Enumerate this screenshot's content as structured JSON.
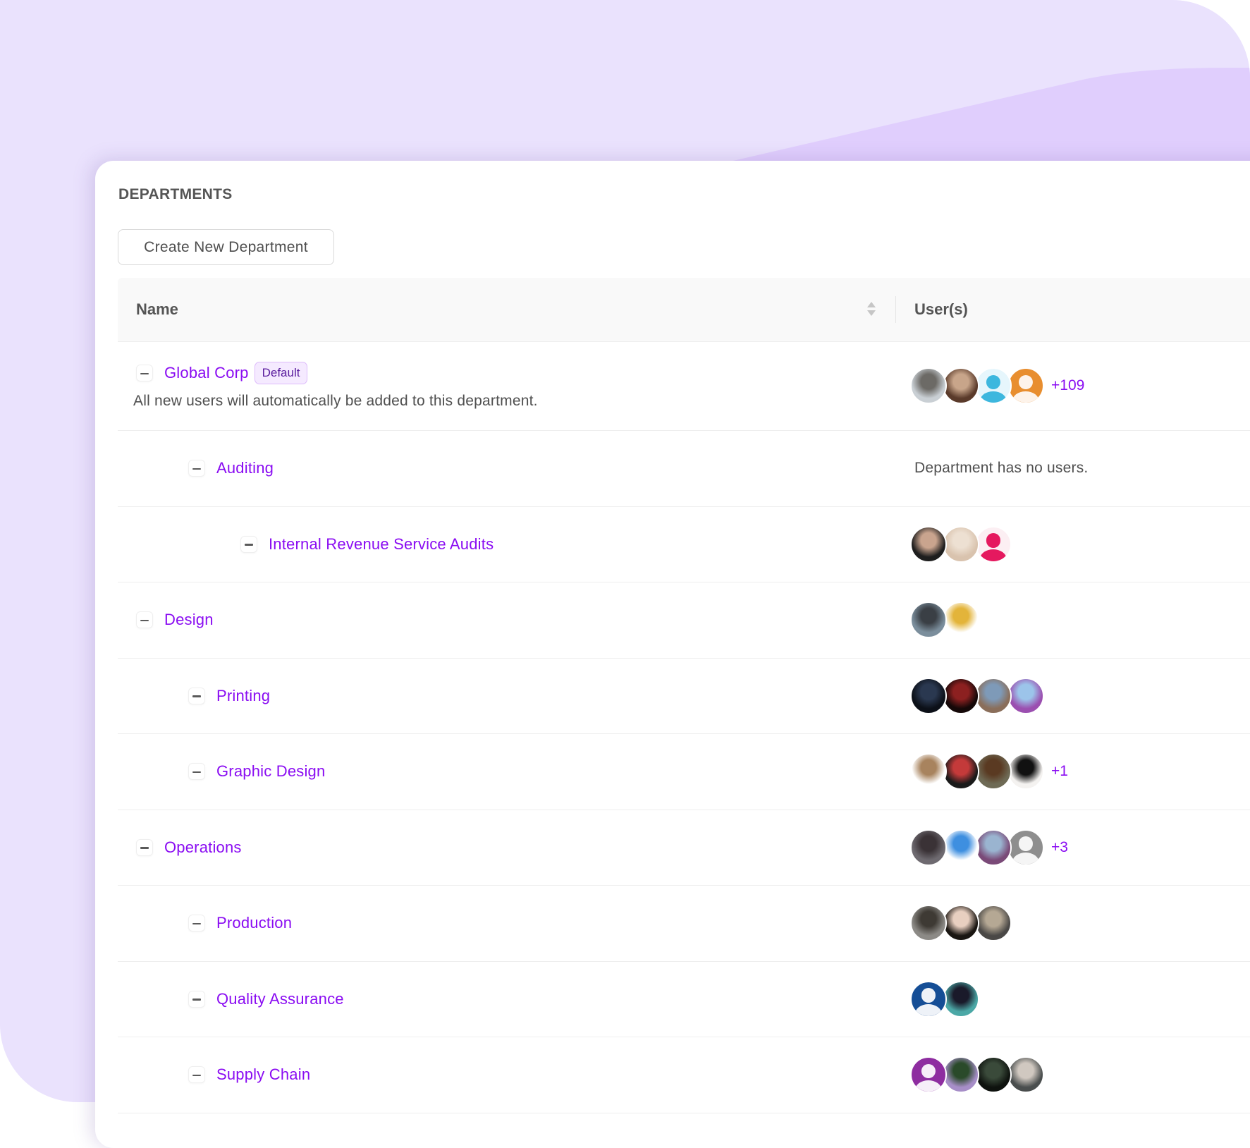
{
  "page": {
    "title": "DEPARTMENTS",
    "create_button": "Create New Department"
  },
  "colors": {
    "accent": "#8A0CF2",
    "background": "#EAE2FD",
    "background_wave": "#E0CEFD"
  },
  "table": {
    "columns": [
      {
        "label": "Name",
        "sortable": true,
        "sort_icon": "sort-updown-icon"
      },
      {
        "label": "User(s)"
      }
    ],
    "rows": [
      {
        "name": "Global Corp",
        "level": 0,
        "expanded": true,
        "badge": "Default",
        "description": "All new users will automatically be added to this department.",
        "avatars": [
          {
            "type": "photo",
            "colors": [
              "#C9CFD4",
              "#6C6A66"
            ]
          },
          {
            "type": "photo",
            "colors": [
              "#5A3A2A",
              "#C8A58A"
            ]
          },
          {
            "type": "default",
            "colors": [
              "#E6F6FC",
              "#3DB7DE"
            ]
          },
          {
            "type": "default",
            "colors": [
              "#E88E2F",
              "#FDF3EA"
            ]
          }
        ],
        "more": "+109",
        "empty_text": null
      },
      {
        "name": "Auditing",
        "level": 1,
        "expanded": true,
        "avatars": [],
        "more": null,
        "empty_text": "Department has no users."
      },
      {
        "name": "Internal Revenue Service Audits",
        "level": 2,
        "expanded": true,
        "avatars": [
          {
            "type": "photo",
            "colors": [
              "#1E1E1E",
              "#C9A48E"
            ]
          },
          {
            "type": "photo",
            "colors": [
              "#D9C3AE",
              "#EDE0D2"
            ]
          },
          {
            "type": "default",
            "colors": [
              "#FCEFF3",
              "#E5195F"
            ]
          }
        ],
        "more": null,
        "empty_text": null
      },
      {
        "name": "Design",
        "level": 0,
        "expanded": true,
        "avatars": [
          {
            "type": "photo",
            "colors": [
              "#7B8E9C",
              "#3A3F45"
            ]
          },
          {
            "type": "photo",
            "colors": [
              "#FFFFFF",
              "#E3B43A"
            ]
          }
        ],
        "more": null,
        "empty_text": null
      },
      {
        "name": "Printing",
        "level": 1,
        "expanded": true,
        "avatars": [
          {
            "type": "photo",
            "colors": [
              "#0C1018",
              "#2A3850"
            ]
          },
          {
            "type": "photo",
            "colors": [
              "#150808",
              "#8C2020"
            ]
          },
          {
            "type": "photo",
            "colors": [
              "#8A6E5A",
              "#7E9AB8"
            ]
          },
          {
            "type": "photo",
            "colors": [
              "#9B4FB0",
              "#9CC4EA"
            ]
          }
        ],
        "more": null,
        "empty_text": null
      },
      {
        "name": "Graphic Design",
        "level": 1,
        "expanded": true,
        "avatars": [
          {
            "type": "photo",
            "colors": [
              "#FFFFFF",
              "#A8835E"
            ]
          },
          {
            "type": "photo",
            "colors": [
              "#1A1A1A",
              "#C43A3A"
            ]
          },
          {
            "type": "photo",
            "colors": [
              "#6E6A55",
              "#5A3A22"
            ]
          },
          {
            "type": "photo",
            "colors": [
              "#F4F2F0",
              "#111111"
            ]
          }
        ],
        "more": "+1",
        "empty_text": null
      },
      {
        "name": "Operations",
        "level": 0,
        "expanded": true,
        "avatars": [
          {
            "type": "photo",
            "colors": [
              "#6E6A70",
              "#3A3236"
            ]
          },
          {
            "type": "photo",
            "colors": [
              "#FFFFFF",
              "#3E8FE0"
            ]
          },
          {
            "type": "photo",
            "colors": [
              "#7A4A78",
              "#9AB4D0"
            ]
          },
          {
            "type": "default",
            "colors": [
              "#8E8E8E",
              "#F5F5F5"
            ]
          }
        ],
        "more": "+3",
        "empty_text": null
      },
      {
        "name": "Production",
        "level": 1,
        "expanded": true,
        "avatars": [
          {
            "type": "photo",
            "colors": [
              "#8C8A86",
              "#3E3A34"
            ]
          },
          {
            "type": "photo",
            "colors": [
              "#1A1612",
              "#E8CFC0"
            ]
          },
          {
            "type": "photo",
            "colors": [
              "#4A4846",
              "#B5A894"
            ]
          }
        ],
        "more": null,
        "empty_text": null
      },
      {
        "name": "Quality Assurance",
        "level": 1,
        "expanded": true,
        "avatars": [
          {
            "type": "default",
            "colors": [
              "#154E96",
              "#EEF2F8"
            ]
          },
          {
            "type": "photo",
            "colors": [
              "#4BA8A6",
              "#1A1A2A"
            ]
          }
        ],
        "more": null,
        "empty_text": null
      },
      {
        "name": "Supply Chain",
        "level": 1,
        "expanded": true,
        "avatars": [
          {
            "type": "default",
            "colors": [
              "#8E2DA0",
              "#F6EEF8"
            ]
          },
          {
            "type": "photo",
            "colors": [
              "#A78EC8",
              "#2A4A2A"
            ]
          },
          {
            "type": "photo",
            "colors": [
              "#0E120E",
              "#3A4A3A"
            ]
          },
          {
            "type": "photo",
            "colors": [
              "#4A4E4E",
              "#D0C8C0"
            ]
          }
        ],
        "more": null,
        "empty_text": null
      }
    ]
  }
}
